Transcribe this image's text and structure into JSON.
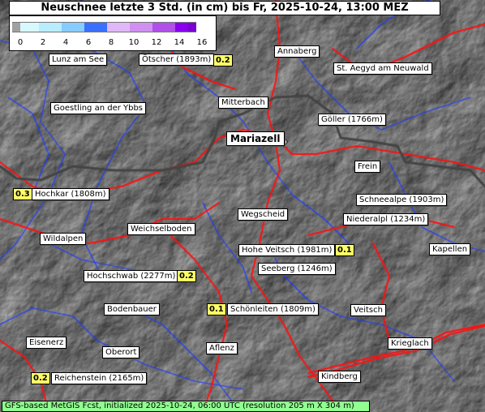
{
  "title": "Neuschnee letzte 3 Std. (in cm) bis Fr, 2025-10-24, 13:00 MEZ",
  "legend": {
    "ticks": [
      "0",
      "2",
      "4",
      "6",
      "8",
      "10",
      "12",
      "14",
      "16"
    ],
    "colors": [
      "#a0a0a0",
      "#d8f8ff",
      "#b8ecff",
      "#88ccff",
      "#3a70ff",
      "#e0b8f8",
      "#d090f0",
      "#b050e8",
      "#8800ee",
      "#7a00d0"
    ]
  },
  "places": [
    {
      "id": "lunz",
      "name": "Lunz am See"
    },
    {
      "id": "oetscher",
      "name": "Ötscher (1893m)",
      "value": "0.2"
    },
    {
      "id": "annaberg",
      "name": "Annaberg"
    },
    {
      "id": "aegyd",
      "name": "St. Aegyd am Neuwald"
    },
    {
      "id": "goestling",
      "name": "Goestling an der Ybbs"
    },
    {
      "id": "mitterbach",
      "name": "Mitterbach"
    },
    {
      "id": "goeller",
      "name": "Göller (1766m)"
    },
    {
      "id": "mariazell",
      "name": "Mariazell"
    },
    {
      "id": "frein",
      "name": "Frein"
    },
    {
      "id": "hochkar",
      "name": "Hochkar (1808m)",
      "value": "0.3"
    },
    {
      "id": "schneealpe",
      "name": "Schneealpe (1903m)"
    },
    {
      "id": "wegscheid",
      "name": "Wegscheid"
    },
    {
      "id": "niederalpl",
      "name": "Niederalpl (1234m)"
    },
    {
      "id": "weichselboden",
      "name": "Weichselboden"
    },
    {
      "id": "wildalpen",
      "name": "Wildalpen"
    },
    {
      "id": "hoheveitsch",
      "name": "Hohe Veitsch (1981m)",
      "value": "0.1"
    },
    {
      "id": "kapellen",
      "name": "Kapellen"
    },
    {
      "id": "seeberg",
      "name": "Seeberg (1246m)"
    },
    {
      "id": "hochschwab",
      "name": "Hochschwab (2277m)",
      "value": "0.2"
    },
    {
      "id": "bodenbauer",
      "name": "Bodenbauer"
    },
    {
      "id": "schoenleiten",
      "name": "Schönleiten (1809m)",
      "value": "0.1"
    },
    {
      "id": "veitsch",
      "name": "Veitsch"
    },
    {
      "id": "eisenerz",
      "name": "Eisenerz"
    },
    {
      "id": "oberort",
      "name": "Oberort"
    },
    {
      "id": "aflenz",
      "name": "Aflenz"
    },
    {
      "id": "krieglach",
      "name": "Krieglach"
    },
    {
      "id": "reichenstein",
      "name": "Reichenstein (2165m)",
      "value": "0.2"
    },
    {
      "id": "kindberg",
      "name": "Kindberg"
    }
  ],
  "footer": "GFS-based MetGIS Fcst, initialized 2025-10-24, 06:00 UTC  (resolution 205 m X 304 m)"
}
